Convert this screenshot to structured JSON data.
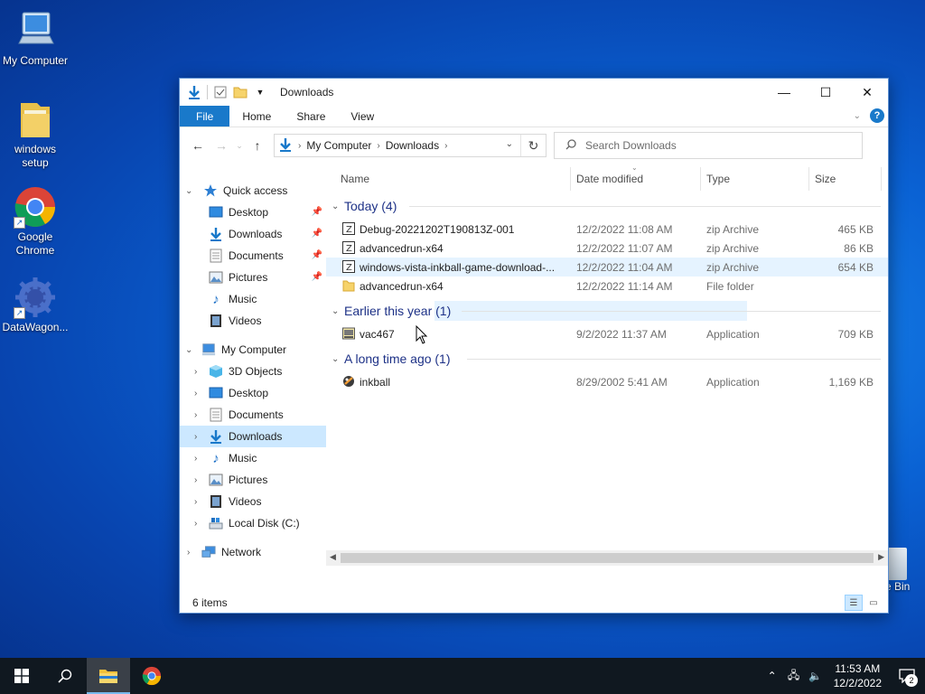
{
  "desktop": {
    "icons": [
      {
        "label": "My Computer"
      },
      {
        "label": "windows setup"
      },
      {
        "label": "Google Chrome"
      },
      {
        "label": "DataWagon..."
      }
    ],
    "recycle_bin_partial": "e Bin"
  },
  "window": {
    "title": "Downloads",
    "ribbon_tabs": [
      "File",
      "Home",
      "Share",
      "View"
    ],
    "help": "?",
    "address": {
      "crumbs": [
        "My Computer",
        "Downloads"
      ]
    },
    "search": {
      "placeholder": "Search Downloads"
    },
    "nav_pane": {
      "quick_access": "Quick access",
      "quick_items": [
        "Desktop",
        "Downloads",
        "Documents",
        "Pictures",
        "Music",
        "Videos"
      ],
      "my_computer": "My Computer",
      "computer_items": [
        "3D Objects",
        "Desktop",
        "Documents",
        "Downloads",
        "Music",
        "Pictures",
        "Videos",
        "Local Disk (C:)"
      ],
      "network": "Network"
    },
    "columns": {
      "name": "Name",
      "date": "Date modified",
      "type": "Type",
      "size": "Size"
    },
    "groups": [
      {
        "label": "Today (4)",
        "rows": [
          {
            "name": "Debug-20221202T190813Z-001",
            "date": "12/2/2022 11:08 AM",
            "type": "zip Archive",
            "size": "465 KB",
            "icon": "zip-icon"
          },
          {
            "name": "advancedrun-x64",
            "date": "12/2/2022 11:07 AM",
            "type": "zip Archive",
            "size": "86 KB",
            "icon": "zip-icon"
          },
          {
            "name": "windows-vista-inkball-game-download-...",
            "date": "12/2/2022 11:04 AM",
            "type": "zip Archive",
            "size": "654 KB",
            "icon": "zip-icon"
          },
          {
            "name": "advancedrun-x64",
            "date": "12/2/2022 11:14 AM",
            "type": "File folder",
            "size": "",
            "icon": "folder-icon"
          }
        ]
      },
      {
        "label": "Earlier this year (1)",
        "rows": [
          {
            "name": "vac467",
            "date": "9/2/2022 11:37 AM",
            "type": "Application",
            "size": "709 KB",
            "icon": "app-icon"
          }
        ]
      },
      {
        "label": "A long time ago (1)",
        "rows": [
          {
            "name": "inkball",
            "date": "8/29/2002 5:41 AM",
            "type": "Application",
            "size": "1,169 KB",
            "icon": "inkball-icon"
          }
        ]
      }
    ],
    "status": "6 items"
  },
  "taskbar": {
    "time": "11:53 AM",
    "date": "12/2/2022",
    "notifications": "2"
  }
}
